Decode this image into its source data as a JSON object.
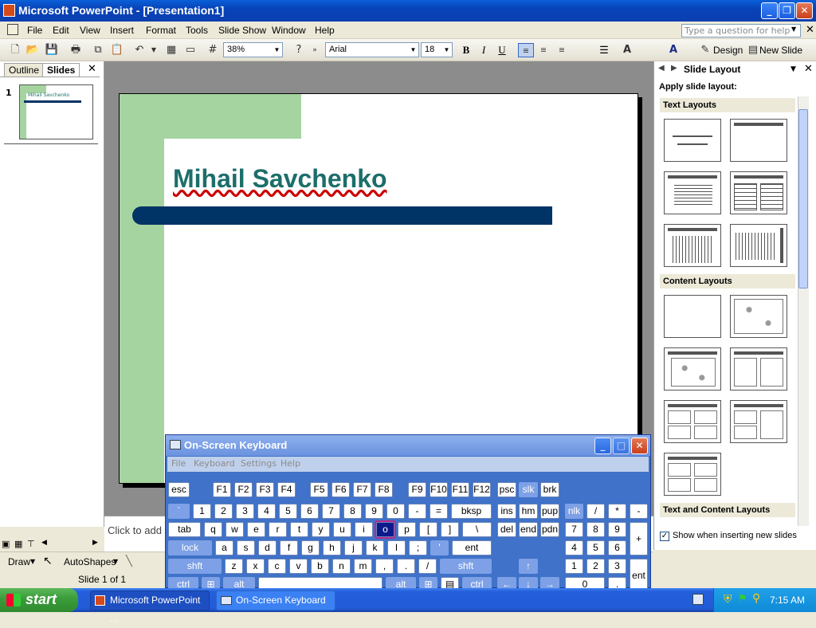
{
  "window": {
    "title": "Microsoft PowerPoint - [Presentation1]"
  },
  "menu": [
    "File",
    "Edit",
    "View",
    "Insert",
    "Format",
    "Tools",
    "Slide Show",
    "Window",
    "Help"
  ],
  "ask": {
    "placeholder": "Type a question for help"
  },
  "toolbar": {
    "zoom": "38%",
    "font": "Arial",
    "size": "18",
    "design": "Design",
    "new_slide": "New Slide"
  },
  "left_pane": {
    "tab_outline": "Outline",
    "tab_slides": "Slides",
    "slide_number": "1",
    "thumb_title": "Mihail Savchenko"
  },
  "slide": {
    "title": "Mihail Savchenko",
    "colors": {
      "green": "#a6d4a0",
      "bar": "#003366",
      "title": "#1c6e6a"
    }
  },
  "notes": {
    "placeholder": "Click to add"
  },
  "task_pane": {
    "title": "Slide Layout",
    "apply": "Apply slide layout:",
    "text_layouts": "Text Layouts",
    "content_layouts": "Content Layouts",
    "text_content_layouts": "Text and Content Layouts",
    "show_check": "Show when inserting new slides"
  },
  "draw": {
    "draw": "Draw",
    "autoshapes": "AutoShapes"
  },
  "status": {
    "slide": "Slide 1 of 1"
  },
  "osk": {
    "title": "On-Screen Keyboard",
    "menu": [
      "File",
      "Keyboard",
      "Settings",
      "Help"
    ]
  },
  "taskbar": {
    "start": "start",
    "ppt": "Microsoft PowerPoint ...",
    "osk": "On-Screen Keyboard",
    "clock": "7:15 AM"
  }
}
